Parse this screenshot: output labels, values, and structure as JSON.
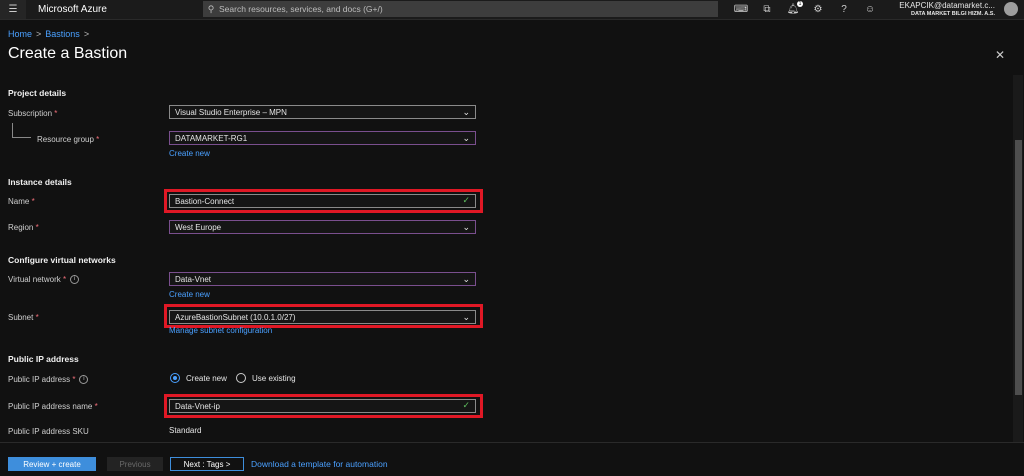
{
  "topbar": {
    "menu_icon": "hamburger-icon",
    "brand": "Microsoft Azure",
    "search_placeholder": "Search resources, services, and docs (G+/)",
    "notification_count": "1",
    "user_email": "EKAPCIK@datamarket.c...",
    "user_org": "DATA MARKET BILGI HIZM. A.S."
  },
  "breadcrumb": {
    "home": "Home",
    "bastions": "Bastions",
    "sep": ">"
  },
  "page": {
    "title": "Create a Bastion",
    "close": "✕"
  },
  "form": {
    "project_details": "Project details",
    "subscription_label": "Subscription",
    "subscription_value": "Visual Studio Enterprise – MPN",
    "resource_group_label": "Resource group",
    "resource_group_value": "DATAMARKET-RG1",
    "create_new_rg": "Create new",
    "instance_details": "Instance details",
    "name_label": "Name",
    "name_value": "Bastion-Connect",
    "region_label": "Region",
    "region_value": "West Europe",
    "configure_vnets": "Configure virtual networks",
    "vnet_label": "Virtual network",
    "vnet_value": "Data-Vnet",
    "create_new_vnet": "Create new",
    "subnet_label": "Subnet",
    "subnet_value": "AzureBastionSubnet (10.0.1.0/27)",
    "manage_subnet": "Manage subnet configuration",
    "public_ip": "Public IP address",
    "pip_label": "Public IP address",
    "pip_create_new": "Create new",
    "pip_use_existing": "Use existing",
    "pip_name_label": "Public IP address name",
    "pip_name_value": "Data-Vnet-ip",
    "pip_sku_label": "Public IP address SKU",
    "pip_sku_value": "Standard",
    "required_mark": "*"
  },
  "footer": {
    "review_create": "Review + create",
    "previous": "Previous",
    "next": "Next : Tags >",
    "download_template": "Download a template for automation"
  },
  "colors": {
    "accent": "#3e8edc",
    "highlight": "#e01825",
    "link": "#4aa0ff"
  }
}
